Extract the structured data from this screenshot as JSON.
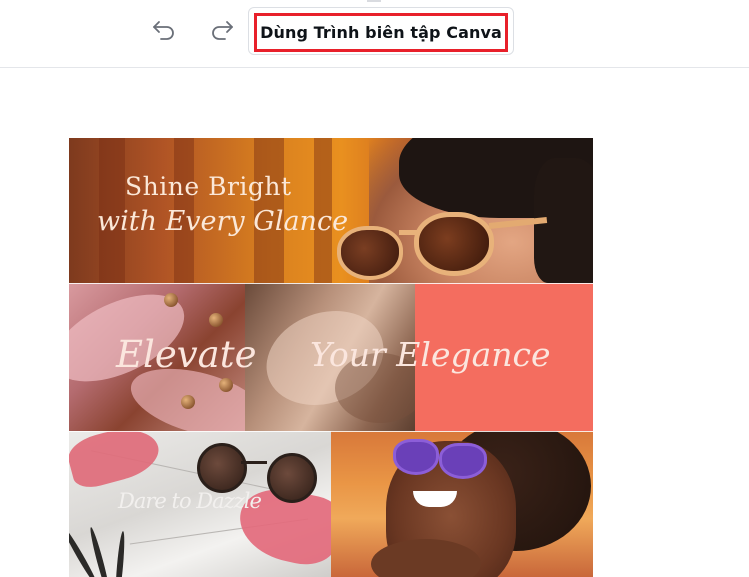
{
  "toolbar": {
    "undo_icon": "undo-icon",
    "redo_icon": "redo-icon",
    "edit_button_label": "Dùng Trình biên tập Canva",
    "highlight_color": "#e8202a"
  },
  "collage": {
    "top_line1": "Shine Bright",
    "top_line2": "with Every Glance",
    "mid_left": "Elevate",
    "mid_right": "Your Elegance",
    "bottom_left": "Dare to Dazzle",
    "accent_color": "#f46d5f"
  }
}
